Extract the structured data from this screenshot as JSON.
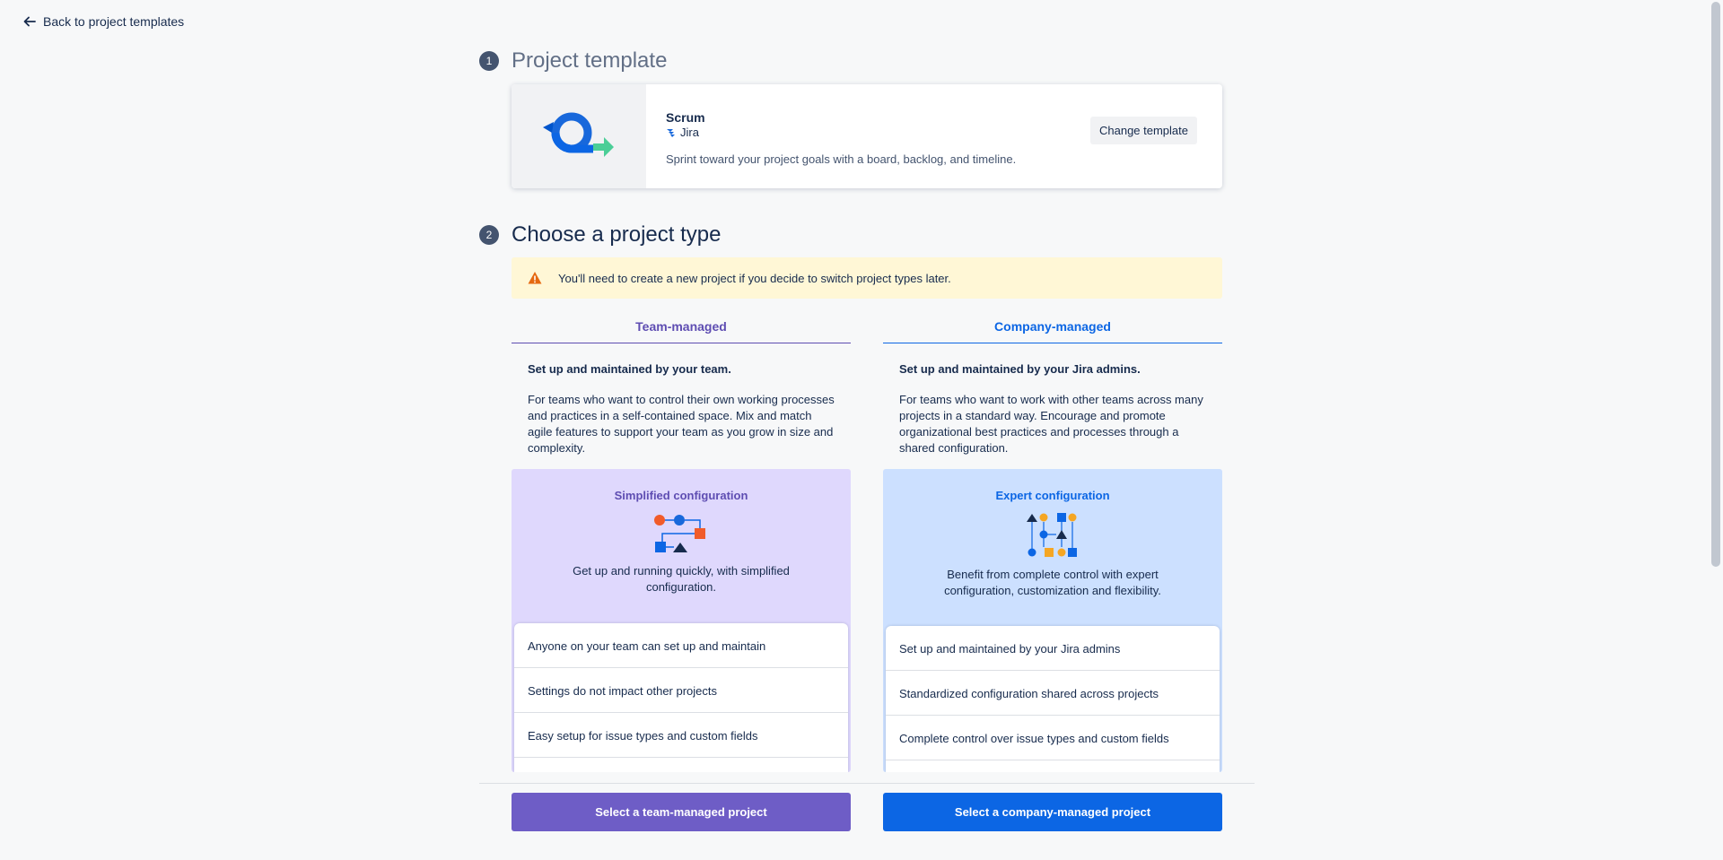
{
  "back_link": {
    "label": "Back to project templates",
    "icon": "arrow-left-icon"
  },
  "step1": {
    "number": "1",
    "title": "Project template",
    "template": {
      "name": "Scrum",
      "product": "Jira",
      "description": "Sprint toward your project goals with a board, backlog, and timeline.",
      "change_button": "Change template"
    }
  },
  "step2": {
    "number": "2",
    "title": "Choose a project type",
    "warning": "You'll need to create a new project if you decide to switch project types later.",
    "team": {
      "tab": "Team-managed",
      "summary": "Set up and maintained by your team.",
      "description": "For teams who want to control their own working processes and practices in a self-contained space. Mix and match agile features to support your team as you grow in size and complexity.",
      "config_title": "Simplified configuration",
      "config_text": "Get up and running quickly, with simplified configuration.",
      "features": [
        "Anyone on your team can set up and maintain",
        "Settings do not impact other projects",
        "Easy setup for issue types and custom fields"
      ],
      "select_button": "Select a team-managed project"
    },
    "company": {
      "tab": "Company-managed",
      "summary": "Set up and maintained by your Jira admins.",
      "description": "For teams who want to work with other teams across many projects in a standard way. Encourage and promote organizational best practices and processes through a shared configuration.",
      "config_title": "Expert configuration",
      "config_text": "Benefit from complete control with expert configuration, customization and flexibility.",
      "features": [
        "Set up and maintained by your Jira admins",
        "Standardized configuration shared across projects",
        "Complete control over issue types and custom fields"
      ],
      "select_button": "Select a company-managed project"
    }
  },
  "colors": {
    "team_accent": "#5e4db2",
    "company_accent": "#0c66e4",
    "warning_bg": "#fff7d6"
  }
}
